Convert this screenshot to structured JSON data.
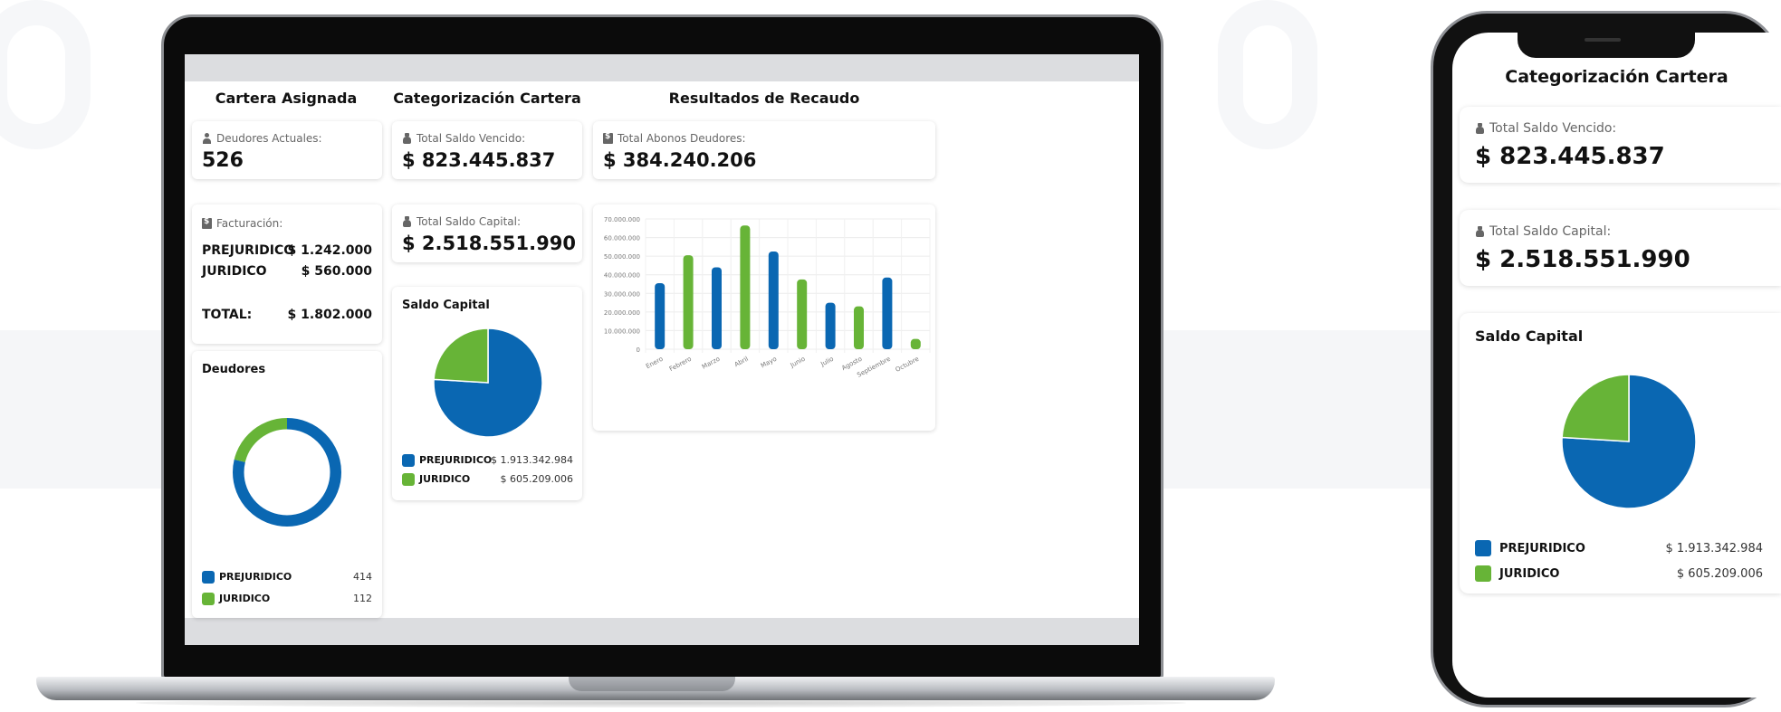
{
  "colors": {
    "blue": "#0a67b2",
    "green": "#67b437"
  },
  "laptop": {
    "cartera": {
      "title": "Cartera Asignada",
      "deudores_label": "Deudores Actuales:",
      "deudores_value": "526",
      "facturacion_label": "Facturación:",
      "rows": [
        {
          "label": "PREJURIDICO",
          "value": "$ 1.242.000"
        },
        {
          "label": "JURIDICO",
          "value": "$ 560.000"
        }
      ],
      "total_label": "TOTAL:",
      "total_value": "$ 1.802.000",
      "deudores_chart": {
        "title": "Deudores",
        "legend": [
          {
            "label": "PREJURIDICO",
            "value": "414"
          },
          {
            "label": "JURIDICO",
            "value": "112"
          }
        ]
      }
    },
    "categorizacion": {
      "title": "Categorización Cartera",
      "vencido_label": "Total Saldo Vencido:",
      "vencido_value": "$ 823.445.837",
      "capital_label": "Total Saldo Capital:",
      "capital_value": "$ 2.518.551.990",
      "saldo_chart": {
        "title": "Saldo Capital",
        "legend": [
          {
            "label": "PREJURIDICO",
            "value": "$ 1.913.342.984"
          },
          {
            "label": "JURIDICO",
            "value": "$ 605.209.006"
          }
        ]
      }
    },
    "resultados": {
      "title": "Resultados de Recaudo",
      "abonos_label": "Total Abonos Deudores:",
      "abonos_value": "$ 384.240.206"
    }
  },
  "phone": {
    "title": "Categorización Cartera",
    "vencido_label": "Total Saldo Vencido:",
    "vencido_value": "$ 823.445.837",
    "capital_label": "Total Saldo Capital:",
    "capital_value": "$ 2.518.551.990",
    "saldo_title": "Saldo Capital",
    "legend": [
      {
        "label": "PREJURIDICO",
        "value": "$ 1.913.342.984"
      },
      {
        "label": "JURIDICO",
        "value": "$ 605.209.006"
      }
    ]
  },
  "chart_data": [
    {
      "type": "pie",
      "variant": "donut",
      "title": "Deudores",
      "labels": [
        "PREJURIDICO",
        "JURIDICO"
      ],
      "values": [
        414,
        112
      ],
      "colors": [
        "#0a67b2",
        "#67b437"
      ]
    },
    {
      "type": "pie",
      "title": "Saldo Capital",
      "labels": [
        "PREJURIDICO",
        "JURIDICO"
      ],
      "values": [
        1913342984,
        605209006
      ],
      "colors": [
        "#0a67b2",
        "#67b437"
      ]
    },
    {
      "type": "bar",
      "categories": [
        "Enero",
        "Febrero",
        "Marzo",
        "Abril",
        "Mayo",
        "Junio",
        "Julio",
        "Agosto",
        "Septiembre",
        "Octubre"
      ],
      "values": [
        35500000,
        50500000,
        44000000,
        66500000,
        52500000,
        37500000,
        25000000,
        23000000,
        38500000,
        5500000
      ],
      "colors": [
        "#0a67b2",
        "#67b437",
        "#0a67b2",
        "#67b437",
        "#0a67b2",
        "#67b437",
        "#0a67b2",
        "#67b437",
        "#0a67b2",
        "#67b437"
      ],
      "yticks": [
        "0",
        "10.000.000",
        "20.000.000",
        "30.000.000",
        "40.000.000",
        "50.000.000",
        "60.000.000",
        "70.000.000"
      ],
      "ylim": [
        0,
        70000000
      ],
      "grid": true
    }
  ]
}
